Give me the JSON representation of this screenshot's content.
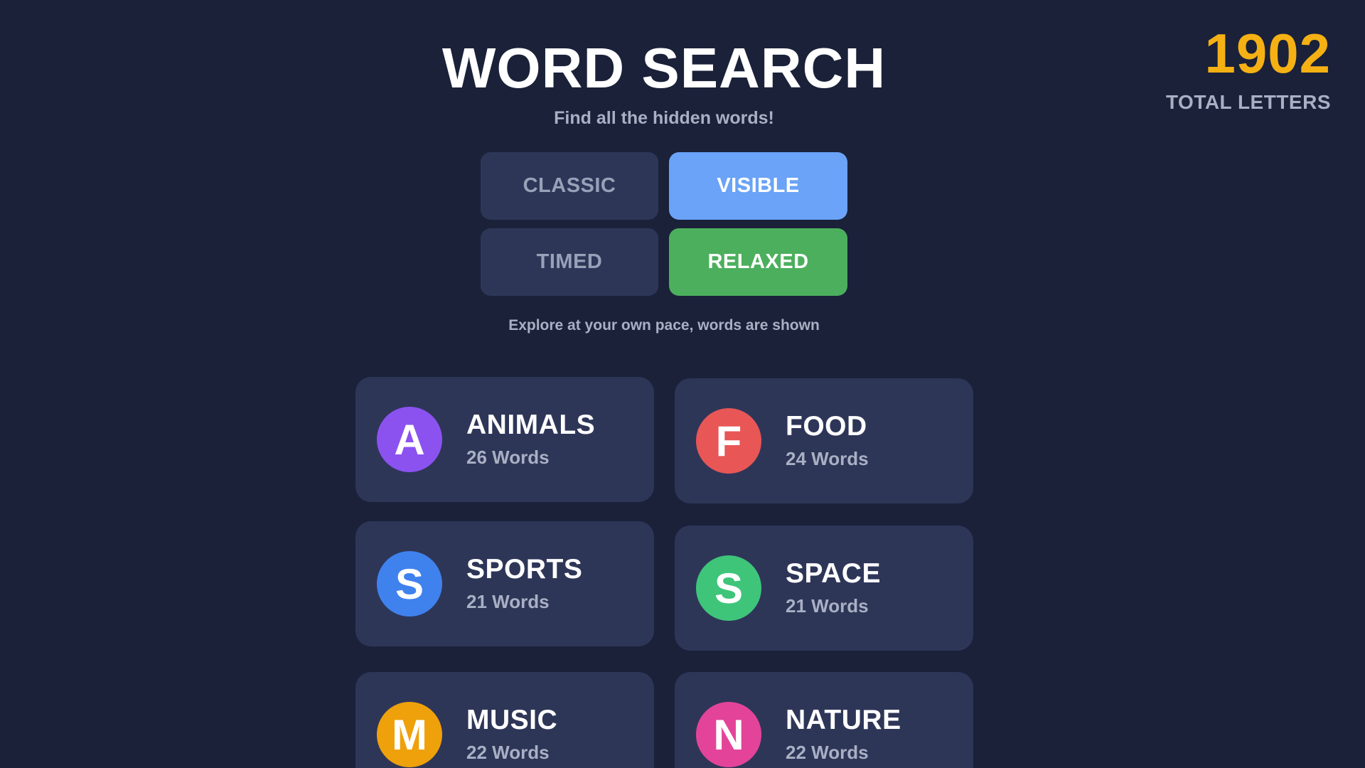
{
  "header": {
    "title": "WORD SEARCH",
    "subtitle": "Find all the hidden words!"
  },
  "score": {
    "value": "1902",
    "label": "TOTAL LETTERS",
    "color": "#f5b114"
  },
  "modes": {
    "classic": "CLASSIC",
    "visible": "VISIBLE",
    "timed": "TIMED",
    "relaxed": "RELAXED",
    "selected_display": "VISIBLE",
    "selected_pace": "RELAXED",
    "description": "Explore at your own pace, words are shown"
  },
  "categories": [
    {
      "letter": "A",
      "name": "ANIMALS",
      "count": "26 Words",
      "color": "#8b52f0"
    },
    {
      "letter": "F",
      "name": "FOOD",
      "count": "24 Words",
      "color": "#e85656"
    },
    {
      "letter": "S",
      "name": "SPORTS",
      "count": "21 Words",
      "color": "#3f82ee"
    },
    {
      "letter": "S",
      "name": "SPACE",
      "count": "21 Words",
      "color": "#3ec57a"
    },
    {
      "letter": "M",
      "name": "MUSIC",
      "count": "22 Words",
      "color": "#efa10b"
    },
    {
      "letter": "N",
      "name": "NATURE",
      "count": "22 Words",
      "color": "#e3449a"
    }
  ],
  "colors": {
    "background": "#1a2139",
    "card": "#2e3658",
    "visible_active": "#6aa3f7",
    "relaxed_active": "#4caf5d"
  }
}
